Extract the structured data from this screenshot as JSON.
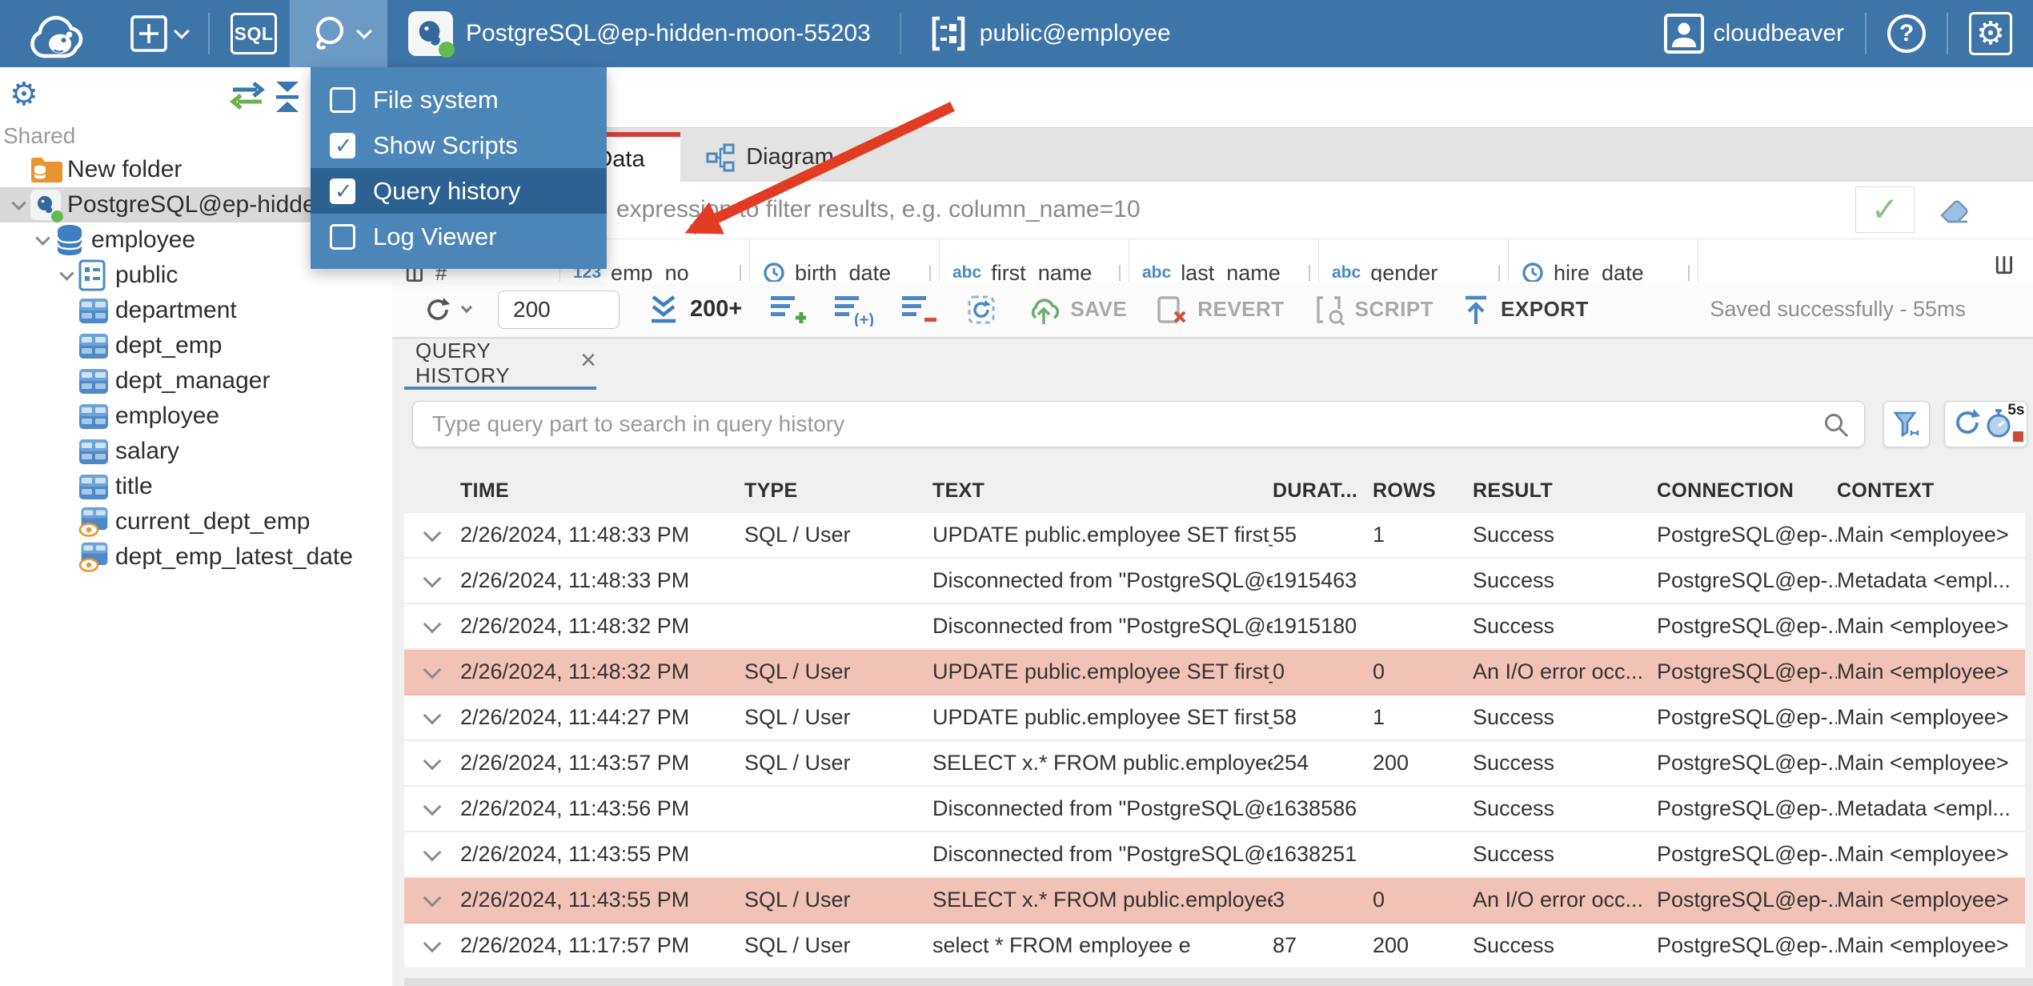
{
  "colors": {
    "topbar": "#3e75a8",
    "tools_button_active": "#6b9ac4",
    "menu_bg": "#4c86b8",
    "menu_highlight": "#2d6191",
    "accent_blue": "#4a87c6",
    "tab_active_border": "#d3413d",
    "error_row_bg": "#f2c2b7",
    "annotation_arrow": "#e23b24",
    "selected_tree_row": "#d9d9d9"
  },
  "icons": {
    "num_label": "123",
    "abc_label": "abc",
    "gear": "⚙",
    "check": "✓",
    "close": "×",
    "question": "?",
    "hash": "#",
    "sort": "▲"
  },
  "topbar": {
    "sql_label": "SQL",
    "connection": "PostgreSQL@ep-hidden-moon-55203",
    "schema": "public@employee",
    "user": "cloudbeaver"
  },
  "tools_menu": {
    "items": [
      {
        "label": "File system",
        "checked": false,
        "highlighted": false
      },
      {
        "label": "Show Scripts",
        "checked": true,
        "highlighted": false
      },
      {
        "label": "Query history",
        "checked": true,
        "highlighted": true
      },
      {
        "label": "Log Viewer",
        "checked": false,
        "highlighted": false
      }
    ]
  },
  "sidebar": {
    "section": "Shared",
    "tree": [
      {
        "label": "New folder",
        "icon": "folder-db",
        "indent": 1,
        "chevron": false,
        "selected": false
      },
      {
        "label": "PostgreSQL@ep-hidden-moon-55203",
        "icon": "postgres",
        "indent": 0,
        "chevron": true,
        "selected": true
      },
      {
        "label": "employee",
        "icon": "database",
        "indent": 1,
        "chevron": true,
        "selected": false
      },
      {
        "label": "public",
        "icon": "schema",
        "indent": 2,
        "chevron": true,
        "selected": false
      },
      {
        "label": "department",
        "icon": "table",
        "indent": 3,
        "chevron": false,
        "selected": false
      },
      {
        "label": "dept_emp",
        "icon": "table",
        "indent": 3,
        "chevron": false,
        "selected": false
      },
      {
        "label": "dept_manager",
        "icon": "table",
        "indent": 3,
        "chevron": false,
        "selected": false
      },
      {
        "label": "employee",
        "icon": "table",
        "indent": 3,
        "chevron": false,
        "selected": false
      },
      {
        "label": "salary",
        "icon": "table",
        "indent": 3,
        "chevron": false,
        "selected": false
      },
      {
        "label": "title",
        "icon": "table",
        "indent": 3,
        "chevron": false,
        "selected": false
      },
      {
        "label": "current_dept_emp",
        "icon": "view",
        "indent": 3,
        "chevron": false,
        "selected": false
      },
      {
        "label": "dept_emp_latest_date",
        "icon": "view",
        "indent": 3,
        "chevron": false,
        "selected": false
      }
    ]
  },
  "main": {
    "tabs": [
      {
        "label": "Data"
      },
      {
        "label": "Diagram"
      }
    ],
    "filter_placeholder": "expression to filter results, e.g. column_name=10",
    "grid_columns": [
      {
        "icon": "num",
        "label": "emp_no"
      },
      {
        "icon": "clock",
        "label": "birth_date"
      },
      {
        "icon": "abc",
        "label": "first_name"
      },
      {
        "icon": "abc",
        "label": "last_name"
      },
      {
        "icon": "abc",
        "label": "gender"
      },
      {
        "icon": "clock",
        "label": "hire_date"
      }
    ],
    "toolbar": {
      "row_limit": "200",
      "fetch_label": "200+",
      "save_label": "SAVE",
      "revert_label": "REVERT",
      "script_label": "SCRIPT",
      "export_label": "EXPORT",
      "status": "Saved successfully - 55ms"
    }
  },
  "history": {
    "tab_label": "QUERY HISTORY",
    "search_placeholder": "Type query part to search in query history",
    "refresh_interval": "5s",
    "columns": [
      "TIME",
      "TYPE",
      "TEXT",
      "DURAT...",
      "ROWS",
      "RESULT",
      "CONNECTION",
      "CONTEXT"
    ],
    "rows": [
      {
        "time": "2/26/2024, 11:48:33 PM",
        "type": "SQL / User",
        "text": "UPDATE public.employee SET first_...",
        "duration": "55",
        "rows": "1",
        "result": "Success",
        "connection": "PostgreSQL@ep-...",
        "context": "Main <employee>",
        "error": false
      },
      {
        "time": "2/26/2024, 11:48:33 PM",
        "type": "",
        "text": "Disconnected from \"PostgreSQL@e...",
        "duration": "1915463",
        "rows": "",
        "result": "Success",
        "connection": "PostgreSQL@ep-...",
        "context": "Metadata <empl...",
        "error": false
      },
      {
        "time": "2/26/2024, 11:48:32 PM",
        "type": "",
        "text": "Disconnected from \"PostgreSQL@e...",
        "duration": "1915180",
        "rows": "",
        "result": "Success",
        "connection": "PostgreSQL@ep-...",
        "context": "Main <employee>",
        "error": false
      },
      {
        "time": "2/26/2024, 11:48:32 PM",
        "type": "SQL / User",
        "text": "UPDATE public.employee SET first_...",
        "duration": "0",
        "rows": "0",
        "result": "An I/O error occ...",
        "connection": "PostgreSQL@ep-...",
        "context": "Main <employee>",
        "error": true
      },
      {
        "time": "2/26/2024, 11:44:27 PM",
        "type": "SQL / User",
        "text": "UPDATE public.employee SET first_...",
        "duration": "58",
        "rows": "1",
        "result": "Success",
        "connection": "PostgreSQL@ep-...",
        "context": "Main <employee>",
        "error": false
      },
      {
        "time": "2/26/2024, 11:43:57 PM",
        "type": "SQL / User",
        "text": "SELECT x.* FROM public.employee x",
        "duration": "254",
        "rows": "200",
        "result": "Success",
        "connection": "PostgreSQL@ep-...",
        "context": "Main <employee>",
        "error": false
      },
      {
        "time": "2/26/2024, 11:43:56 PM",
        "type": "",
        "text": "Disconnected from \"PostgreSQL@e...",
        "duration": "1638586",
        "rows": "",
        "result": "Success",
        "connection": "PostgreSQL@ep-...",
        "context": "Metadata <empl...",
        "error": false
      },
      {
        "time": "2/26/2024, 11:43:55 PM",
        "type": "",
        "text": "Disconnected from \"PostgreSQL@e...",
        "duration": "1638251",
        "rows": "",
        "result": "Success",
        "connection": "PostgreSQL@ep-...",
        "context": "Main <employee>",
        "error": false
      },
      {
        "time": "2/26/2024, 11:43:55 PM",
        "type": "SQL / User",
        "text": "SELECT x.* FROM public.employee x",
        "duration": "3",
        "rows": "0",
        "result": "An I/O error occ...",
        "connection": "PostgreSQL@ep-...",
        "context": "Main <employee>",
        "error": true
      },
      {
        "time": "2/26/2024, 11:17:57 PM",
        "type": "SQL / User",
        "text": "select * FROM employee e",
        "duration": "87",
        "rows": "200",
        "result": "Success",
        "connection": "PostgreSQL@ep-...",
        "context": "Main <employee>",
        "error": false
      }
    ]
  }
}
